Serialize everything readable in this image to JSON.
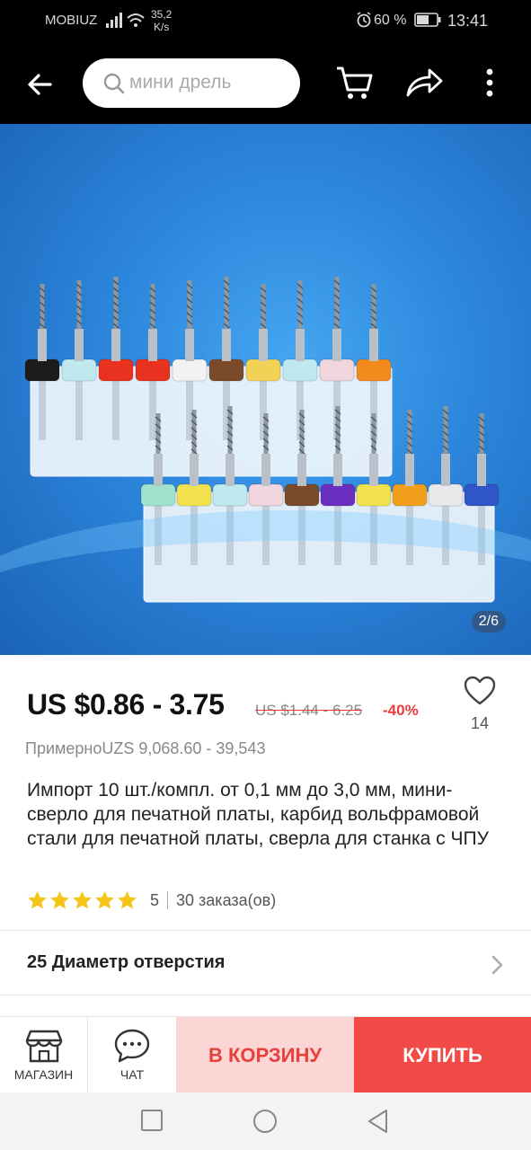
{
  "status_bar": {
    "carrier": "MOBIUZ",
    "speed_value": "35,2",
    "speed_unit": "K/s",
    "battery_percent": "60 %",
    "time": "13:41",
    "icons": [
      "signal-icon",
      "wifi-icon",
      "alarm-icon",
      "battery-icon"
    ]
  },
  "header": {
    "search_placeholder": "мини дрель",
    "icons": [
      "back-arrow-icon",
      "search-icon",
      "cart-icon",
      "share-icon",
      "more-vertical-icon"
    ]
  },
  "gallery": {
    "counter": "2/6",
    "drill_cap_colors_top": [
      "#1c1c1c",
      "#bfe9ef",
      "#e8321f",
      "#e8321f",
      "#f2f2f2",
      "#7b4a2a",
      "#f2d256",
      "#bfe9ef",
      "#f1d6dd",
      "#f28a1c"
    ],
    "drill_cap_colors_bottom": [
      "#9fe3cf",
      "#f1e24e",
      "#bfe9ef",
      "#f1d6dd",
      "#7b4a2a",
      "#6a2fbf",
      "#f1e24e",
      "#f2a01c",
      "#e8e8e8",
      "#2f55c9"
    ]
  },
  "product": {
    "price": "US $0.86 - 3.75",
    "old_price": "US $1.44 - 6.25",
    "discount": "-40%",
    "wishlist_count": "14",
    "approx_price": "ПримерноUZS 9,068.60 - 39,543",
    "title": "Импорт 10 шт./компл. от 0,1 мм до 3,0 мм, мини-сверло для печатной платы, карбид вольфрамовой стали для печатной платы, сверла для станка с ЧПУ",
    "rating": 5,
    "rating_label": "5",
    "orders": "30 заказа(ов)"
  },
  "variant": {
    "label": "25 Диаметр отверстия"
  },
  "actions": {
    "store_label": "МАГАЗИН",
    "chat_label": "ЧАТ",
    "add_to_cart_label": "В КОРЗИНУ",
    "buy_label": "КУПИТЬ"
  },
  "colors": {
    "accent": "#f24a47",
    "cart_bg": "#fcd5d5",
    "star": "#f5c518",
    "discount": "#ec3b3b"
  }
}
